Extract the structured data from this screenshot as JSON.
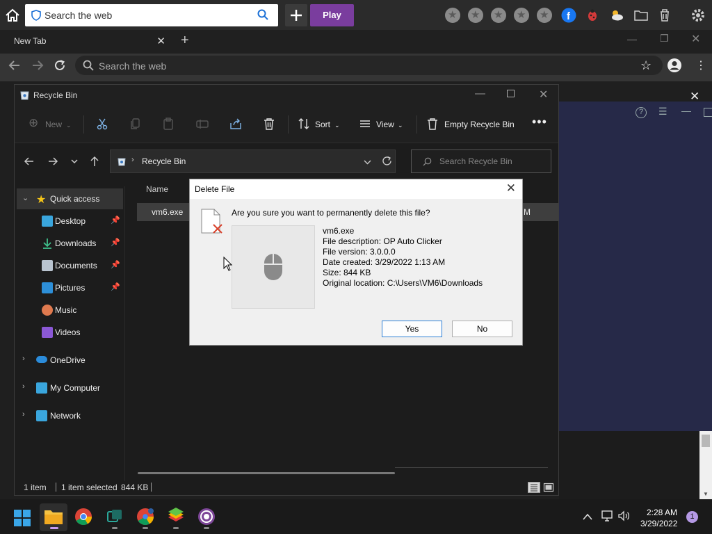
{
  "toolbar": {
    "search_placeholder": "Search the web",
    "play_label": "Play",
    "icons": [
      "home-icon",
      "shield-icon",
      "search-icon",
      "plus-icon",
      "star-icon",
      "facebook-icon",
      "ladybug-icon",
      "weather-icon",
      "folder-icon",
      "trash-icon",
      "gear-icon"
    ]
  },
  "browser": {
    "tab_title": "New Tab",
    "address_placeholder": "Search the web"
  },
  "explorer": {
    "window_title": "Recycle Bin",
    "commands": {
      "new_label": "New",
      "sort_label": "Sort",
      "view_label": "View",
      "empty_label": "Empty Recycle Bin"
    },
    "breadcrumb": "Recycle Bin",
    "search_placeholder": "Search Recycle Bin",
    "sidebar": {
      "quick_access": "Quick access",
      "items": [
        {
          "label": "Desktop",
          "pinned": true
        },
        {
          "label": "Downloads",
          "pinned": true
        },
        {
          "label": "Documents",
          "pinned": true
        },
        {
          "label": "Pictures",
          "pinned": true
        },
        {
          "label": "Music",
          "pinned": false
        },
        {
          "label": "Videos",
          "pinned": false
        }
      ],
      "onedrive": "OneDrive",
      "my_computer": "My Computer",
      "network": "Network"
    },
    "column_name": "Name",
    "file": {
      "name": "vm6.exe",
      "trail": "M"
    },
    "status": {
      "count": "1 item",
      "selected": "1 item selected",
      "size": "844 KB"
    }
  },
  "dialog": {
    "title": "Delete File",
    "question": "Are you sure you want to permanently delete this file?",
    "file_name": "vm6.exe",
    "description": "File description: OP Auto Clicker",
    "version": "File version: 3.0.0.0",
    "created": "Date created: 3/29/2022 1:13 AM",
    "size": "Size: 844 KB",
    "location": "Original location: C:\\Users\\VM6\\Downloads",
    "yes_label": "Yes",
    "no_label": "No"
  },
  "taskbar": {
    "time": "2:28 AM",
    "date": "3/29/2022",
    "notification_count": "1"
  },
  "colors": {
    "play_purple": "#7a3d9e",
    "dialog_bg": "#f0f0f0",
    "panel_navy": "#262948",
    "accent_blue": "#2c7fd6"
  }
}
